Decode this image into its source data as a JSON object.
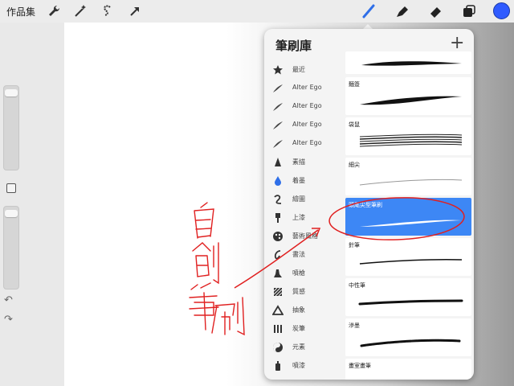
{
  "topbar": {
    "gallery_label": "作品集",
    "tools": [
      "wrench-icon",
      "magic-wand-icon",
      "selection-s-icon",
      "transform-arrow-icon"
    ],
    "right_tools": [
      "brush-icon",
      "smudge-icon",
      "eraser-icon",
      "layers-icon"
    ],
    "color": "#2f5bff"
  },
  "panel": {
    "title": "筆刷庫",
    "add_label": "+",
    "categories": [
      {
        "label": "最近",
        "icon": "star-icon"
      },
      {
        "label": "Alter Ego",
        "icon": "stroke-icon"
      },
      {
        "label": "Alter Ego",
        "icon": "stroke-icon"
      },
      {
        "label": "Alter Ego",
        "icon": "stroke-icon"
      },
      {
        "label": "Alter Ego",
        "icon": "stroke-icon"
      },
      {
        "label": "素描",
        "icon": "pencil-tip-icon"
      },
      {
        "label": "着墨",
        "icon": "ink-drop-icon"
      },
      {
        "label": "繪圖",
        "icon": "loop-icon"
      },
      {
        "label": "上漆",
        "icon": "paint-brush-icon"
      },
      {
        "label": "藝術風格",
        "icon": "palette-icon"
      },
      {
        "label": "書法",
        "icon": "calligraphy-icon"
      },
      {
        "label": "噴槍",
        "icon": "airbrush-icon"
      },
      {
        "label": "質感",
        "icon": "texture-icon"
      },
      {
        "label": "抽象",
        "icon": "triangle-icon"
      },
      {
        "label": "炭筆",
        "icon": "charcoal-icon"
      },
      {
        "label": "元素",
        "icon": "yin-yang-icon"
      },
      {
        "label": "噴漆",
        "icon": "spray-can-icon"
      }
    ],
    "brushes": [
      {
        "name": ""
      },
      {
        "name": "麵簽"
      },
      {
        "name": "袋鼠"
      },
      {
        "name": "細尖"
      },
      {
        "name": "頭尾尖型筆刷",
        "selected": true
      },
      {
        "name": "針筆"
      },
      {
        "name": "中性筆"
      },
      {
        "name": "滲墨"
      },
      {
        "name": "畫室畫筆"
      }
    ],
    "accent": "#3d87f5"
  },
  "annotation": {
    "text": "自創筆刷",
    "color": "#e02020"
  }
}
